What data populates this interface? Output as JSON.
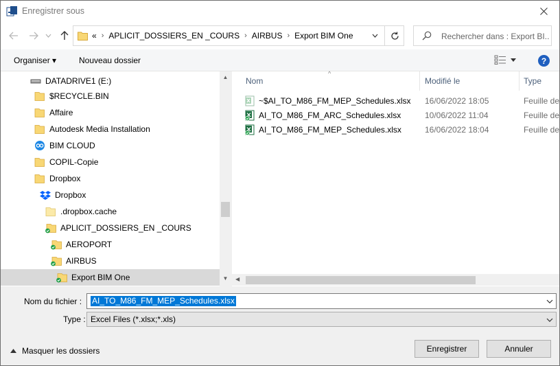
{
  "window": {
    "title": "Enregistrer sous"
  },
  "address": {
    "overflow": "«",
    "crumbs": [
      "APLICIT_DOSSIERS_EN _COURS",
      "AIRBUS",
      "Export BIM One"
    ]
  },
  "search": {
    "placeholder": "Rechercher dans : Export BI..."
  },
  "toolbar": {
    "organize_label": "Organiser ▾",
    "new_folder_label": "Nouveau dossier",
    "help_label": "?"
  },
  "tree": {
    "items": [
      {
        "label": "DATADRIVE1 (E:)",
        "icon": "drive-icon"
      },
      {
        "label": "$RECYCLE.BIN",
        "icon": "folder-icon"
      },
      {
        "label": "Affaire",
        "icon": "folder-icon"
      },
      {
        "label": "Autodesk Media Installation",
        "icon": "folder-icon"
      },
      {
        "label": "BIM CLOUD",
        "icon": "cloud-app-icon"
      },
      {
        "label": "COPIL-Copie",
        "icon": "folder-icon"
      },
      {
        "label": "Dropbox",
        "icon": "folder-icon"
      },
      {
        "label": "Dropbox",
        "icon": "dropbox-icon"
      },
      {
        "label": ".dropbox.cache",
        "icon": "folder-icon"
      },
      {
        "label": "APLICIT_DOSSIERS_EN _COURS",
        "icon": "synced-folder-icon"
      },
      {
        "label": "AEROPORT",
        "icon": "synced-folder-icon"
      },
      {
        "label": "AIRBUS",
        "icon": "synced-folder-icon"
      },
      {
        "label": "Export BIM One",
        "icon": "synced-folder-icon"
      }
    ]
  },
  "columns": {
    "name": "Nom",
    "modified": "Modifié le",
    "type": "Type"
  },
  "files": [
    {
      "name": "~$AI_TO_M86_FM_MEP_Schedules.xlsx",
      "modified": "16/06/2022 18:05",
      "type": "Feuille de",
      "icon": "excel-temp-icon"
    },
    {
      "name": "AI_TO_M86_FM_ARC_Schedules.xlsx",
      "modified": "10/06/2022 11:04",
      "type": "Feuille de",
      "icon": "excel-synced-icon"
    },
    {
      "name": "AI_TO_M86_FM_MEP_Schedules.xlsx",
      "modified": "16/06/2022 18:04",
      "type": "Feuille de",
      "icon": "excel-synced-icon"
    }
  ],
  "footer": {
    "filename_label": "Nom du fichier :",
    "filename_value": "AI_TO_M86_FM_MEP_Schedules.xlsx",
    "type_label": "Type :",
    "type_value": "Excel Files (*.xlsx;*.xls)",
    "hide_folders_label": "Masquer les dossiers",
    "save_label": "Enregistrer",
    "cancel_label": "Annuler"
  },
  "colors": {
    "folder": "#f8d775",
    "synced": "#1e9e47",
    "excel": "#1d6f42",
    "accent": "#0078d7"
  }
}
